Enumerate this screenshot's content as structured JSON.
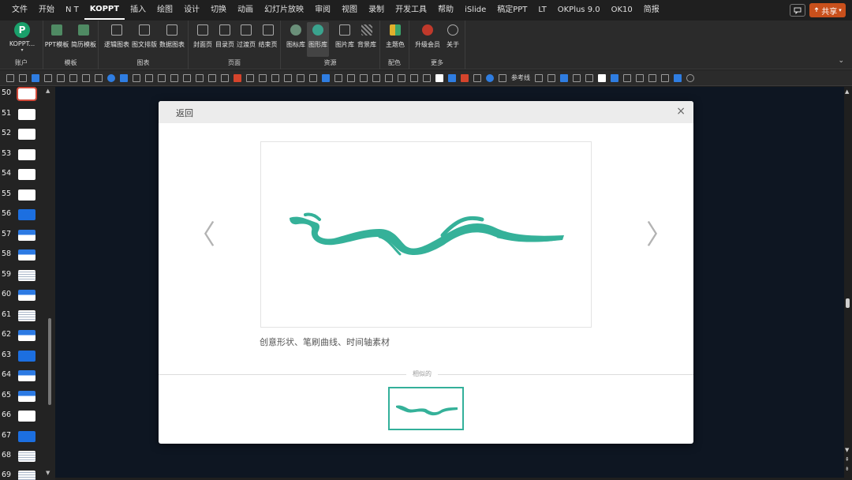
{
  "menubar": {
    "items": [
      "文件",
      "开始",
      "N T",
      "KOPPT",
      "插入",
      "绘图",
      "设计",
      "切换",
      "动画",
      "幻灯片放映",
      "审阅",
      "视图",
      "录制",
      "开发工具",
      "帮助",
      "iSlide",
      "稿定PPT",
      "LT",
      "OKPlus 9.0",
      "OK10",
      "简报"
    ],
    "active_index": 3,
    "share_label": "共享"
  },
  "ribbon": {
    "groups": [
      {
        "label": "账户",
        "buttons": [
          "KOPPT..."
        ]
      },
      {
        "label": "模板",
        "buttons": [
          "PPT模板",
          "简历模板"
        ]
      },
      {
        "label": "图表",
        "buttons": [
          "逻辑图表",
          "图文排版",
          "数据图表"
        ]
      },
      {
        "label": "页面",
        "buttons": [
          "封面页",
          "目录页",
          "过渡页",
          "结束页"
        ]
      },
      {
        "label": "资源",
        "buttons": [
          "图标库",
          "图形库",
          "图片库",
          "背景库"
        ]
      },
      {
        "label": "配色",
        "buttons": [
          "主题色"
        ]
      },
      {
        "label": "更多",
        "buttons": [
          "升级会员",
          "关于"
        ]
      }
    ],
    "selected_button": "图形库",
    "logo_letter": "P"
  },
  "toolbar": {
    "ref_line_label": "参考线"
  },
  "slides": {
    "numbers": [
      "50",
      "51",
      "52",
      "53",
      "54",
      "55",
      "56",
      "57",
      "58",
      "59",
      "60",
      "61",
      "62",
      "63",
      "64",
      "65",
      "66",
      "67",
      "68",
      "69"
    ],
    "selected": "50"
  },
  "dialog": {
    "back_label": "返回",
    "close_glyph": "×",
    "prev_glyph": "〈",
    "next_glyph": "〉",
    "caption": "创意形状、笔刷曲线、时间轴素材",
    "similar_label": "相似的",
    "accent_color": "#35b199"
  },
  "colors": {
    "brush": "#35b199",
    "share": "#c9501c",
    "canvas": "#0e1622"
  }
}
